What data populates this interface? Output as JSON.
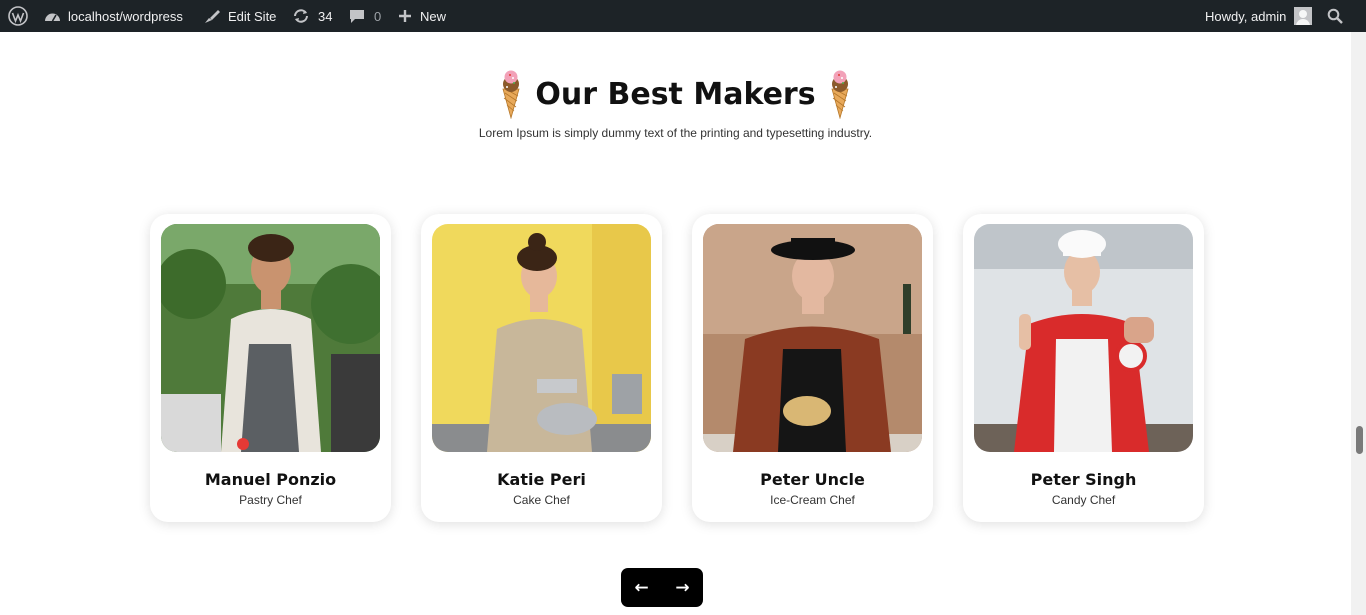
{
  "adminbar": {
    "site": "localhost/wordpress",
    "edit_site": "Edit Site",
    "updates_count": "34",
    "comments_count": "0",
    "new_label": "New",
    "greeting": "Howdy, admin",
    "bg_color": "#1d2327"
  },
  "section": {
    "title": "Our Best Makers",
    "subtitle": "Lorem Ipsum is simply dummy text of the printing and typesetting industry."
  },
  "makers": [
    {
      "name": "Manuel Ponzio",
      "role": "Pastry Chef"
    },
    {
      "name": "Katie Peri",
      "role": "Cake Chef"
    },
    {
      "name": "Peter Uncle",
      "role": "Ice-Cream Chef"
    },
    {
      "name": "Peter Singh",
      "role": "Candy Chef"
    }
  ],
  "nav": {
    "prev_label": "←",
    "next_label": "→"
  }
}
